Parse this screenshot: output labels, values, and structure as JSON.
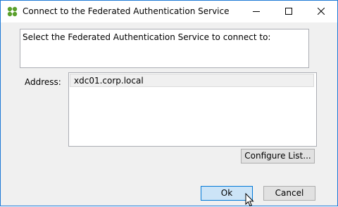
{
  "window": {
    "title": "Connect to the Federated Authentication Service",
    "icon": "four-leaf-app-icon",
    "accent_color": "#1e7ad6"
  },
  "titlebar_buttons": {
    "minimize": "minimize-icon",
    "maximize": "maximize-icon",
    "close": "close-icon"
  },
  "description": "Select the Federated Authentication Service to connect to:",
  "address": {
    "label": "Address:",
    "items": [
      "xdc01.corp.local"
    ]
  },
  "buttons": {
    "configure": "Configure List...",
    "ok": "Ok",
    "cancel": "Cancel"
  }
}
